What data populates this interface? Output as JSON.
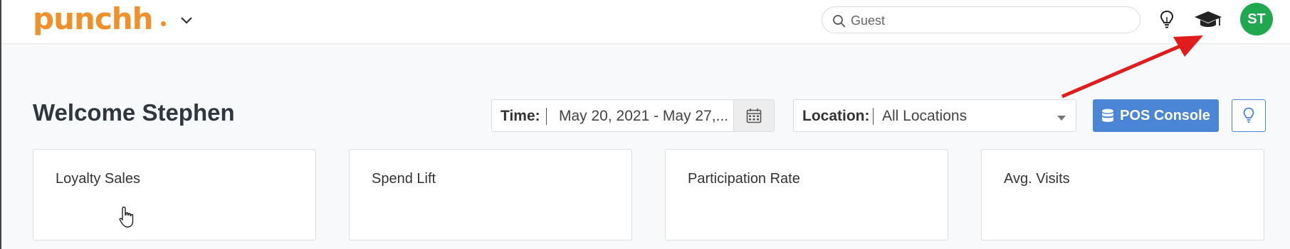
{
  "header": {
    "logo_text": "punchh",
    "search": {
      "placeholder": "Guest",
      "value": ""
    },
    "avatar_initials": "ST",
    "icons": [
      "chevron-down-icon",
      "search-icon",
      "lightbulb-icon",
      "graduation-cap-icon"
    ]
  },
  "dashboard": {
    "welcome": "Welcome Stephen",
    "time": {
      "label": "Time:",
      "value": "May 20, 2021 - May 27,..."
    },
    "location": {
      "label": "Location:",
      "value": "All Locations"
    },
    "pos_console": "POS Console"
  },
  "cards": [
    {
      "title": "Loyalty Sales"
    },
    {
      "title": "Spend Lift"
    },
    {
      "title": "Participation Rate"
    },
    {
      "title": "Avg. Visits"
    }
  ],
  "colors": {
    "brand": "#f0902a",
    "primary": "#4b85d6",
    "avatar": "#1fa84f",
    "annotation_arrow": "#e01c1c"
  }
}
